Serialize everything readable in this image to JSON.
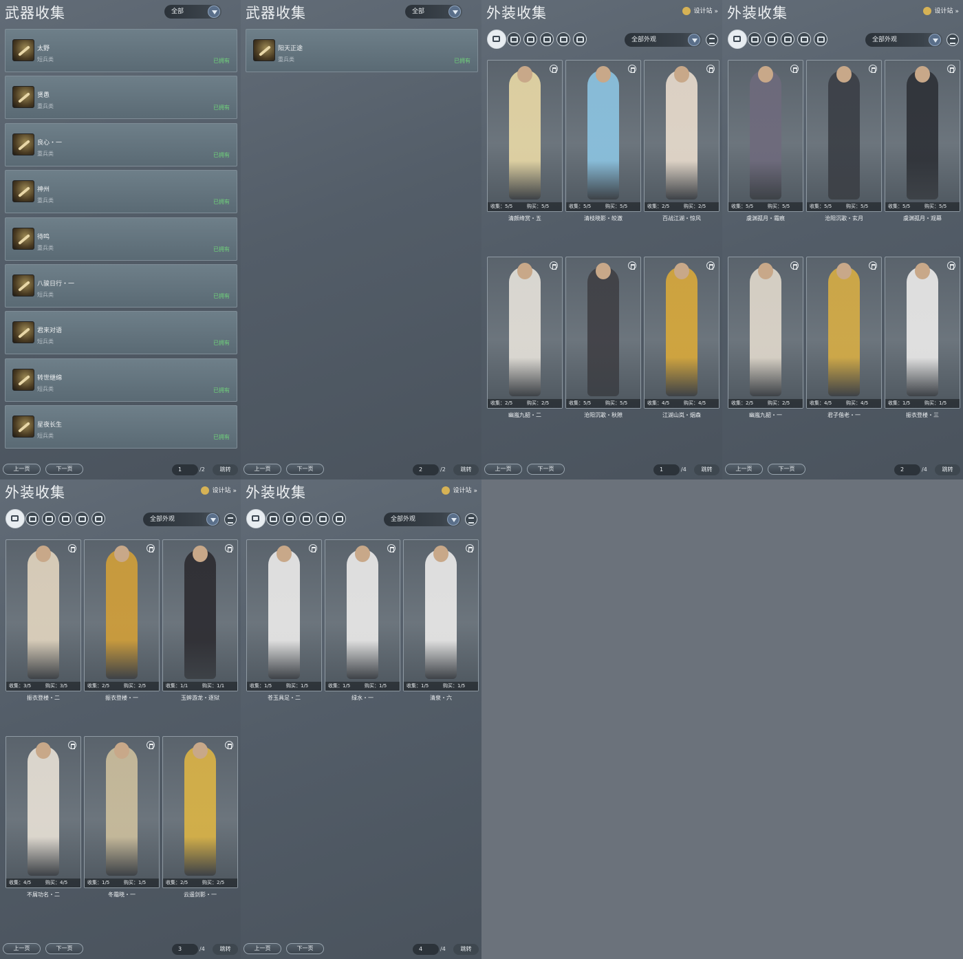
{
  "colors": {
    "owned": "#6fd27a",
    "accent": "#5a6f8a"
  },
  "weapon_panels": [
    {
      "title": "武器收集",
      "filter": "全部",
      "items": [
        {
          "name": "太野",
          "type": "短兵类",
          "status": "已拥有"
        },
        {
          "name": "贤愚",
          "type": "重兵类",
          "status": "已拥有"
        },
        {
          "name": "良心・一",
          "type": "重兵类",
          "status": "已拥有"
        },
        {
          "name": "神州",
          "type": "重兵类",
          "status": "已拥有"
        },
        {
          "name": "待鸣",
          "type": "重兵类",
          "status": "已拥有"
        },
        {
          "name": "八骏日行・一",
          "type": "短兵类",
          "status": "已拥有"
        },
        {
          "name": "君来对语",
          "type": "短兵类",
          "status": "已拥有"
        },
        {
          "name": "转世继绵",
          "type": "短兵类",
          "status": "已拥有"
        },
        {
          "name": "星夜长生",
          "type": "短兵类",
          "status": "已拥有"
        }
      ],
      "pager": {
        "prev": "上一页",
        "next": "下一页",
        "page": "1",
        "total": "/2",
        "jump": "跳转"
      }
    },
    {
      "title": "武器收集",
      "filter": "全部",
      "items": [
        {
          "name": "阳天正途",
          "type": "重兵类",
          "status": "已拥有"
        }
      ],
      "pager": {
        "prev": "上一页",
        "next": "下一页",
        "page": "2",
        "total": "/2",
        "jump": "跳转"
      }
    }
  ],
  "outfit_panels": [
    {
      "title": "外装收集",
      "design": "设计站",
      "filter": "全部外观",
      "cards": [
        {
          "name": "清颜绛赏・五",
          "collect": "收集：5/5",
          "buy": "购买：5/5",
          "color": "#e9d9a6"
        },
        {
          "name": "清枝晓影・皎澈",
          "collect": "收集：5/5",
          "buy": "购买：5/5",
          "color": "#8cc4e2"
        },
        {
          "name": "百战江湖・惊风",
          "collect": "收集：2/5",
          "buy": "购买：2/5",
          "color": "#e9dccd"
        },
        {
          "name": "幽嵐九韶・二",
          "collect": "收集：2/5",
          "buy": "购买：2/5",
          "color": "#e6e2da"
        },
        {
          "name": "沧阳沉歌・秋隙",
          "collect": "收集：5/5",
          "buy": "购买：5/5",
          "color": "#3f3f44"
        },
        {
          "name": "江湖山岚・烟森",
          "collect": "收集：4/5",
          "buy": "购买：4/5",
          "color": "#d9a93a"
        }
      ],
      "pager": {
        "prev": "上一页",
        "next": "下一页",
        "page": "1",
        "total": "/4",
        "jump": "跳转"
      }
    },
    {
      "title": "外装收集",
      "design": "设计站",
      "filter": "全部外观",
      "cards": [
        {
          "name": "虞渊孤月・霜痕",
          "collect": "收集：5/5",
          "buy": "购买：5/5",
          "color": "#6e6a7c"
        },
        {
          "name": "沧阳沉歌・玄月",
          "collect": "收集：5/5",
          "buy": "购买：5/5",
          "color": "#3a3e45"
        },
        {
          "name": "虞渊孤月・观幕",
          "collect": "收集：5/5",
          "buy": "购买：5/5",
          "color": "#2d3036"
        },
        {
          "name": "幽嵐九韶・一",
          "collect": "收集：2/5",
          "buy": "购买：2/5",
          "color": "#e1d9cc"
        },
        {
          "name": "君子偕老・一",
          "collect": "收集：4/5",
          "buy": "购买：4/5",
          "color": "#d7ad44"
        },
        {
          "name": "振衣登楼・三",
          "collect": "收集：1/5",
          "buy": "购买：1/5",
          "color": "#ecebea"
        }
      ],
      "pager": {
        "prev": "上一页",
        "next": "下一页",
        "page": "2",
        "total": "/4",
        "jump": "跳转"
      }
    },
    {
      "title": "外装收集",
      "design": "设计站",
      "filter": "全部外观",
      "cards": [
        {
          "name": "振衣登楼・二",
          "collect": "收集：3/5",
          "buy": "购买：3/5",
          "color": "#e2d5bf"
        },
        {
          "name": "振衣登楼・一",
          "collect": "收集：2/5",
          "buy": "购买：2/5",
          "color": "#d29f38"
        },
        {
          "name": "玉蟀游龙・逐狱",
          "collect": "收集：1/1",
          "buy": "购买：1/1",
          "color": "#2c2b30"
        },
        {
          "name": "不屑功名・二",
          "collect": "收集：4/5",
          "buy": "购买：4/5",
          "color": "#e8e1d6"
        },
        {
          "name": "冬霜晓・一",
          "collect": "收集：1/5",
          "buy": "购买：1/5",
          "color": "#cdbf9d"
        },
        {
          "name": "云遥剑影・一",
          "collect": "收集：2/5",
          "buy": "购买：2/5",
          "color": "#dcb445"
        }
      ],
      "pager": {
        "prev": "上一页",
        "next": "下一页",
        "page": "3",
        "total": "/4",
        "jump": "跳转"
      }
    },
    {
      "title": "外装收集",
      "design": "设计站",
      "filter": "全部外观",
      "cards": [
        {
          "name": "苍玉具足・二",
          "collect": "收集：1/5",
          "buy": "购买：1/5",
          "color": "#ecebea"
        },
        {
          "name": "绿水・一",
          "collect": "收集：1/5",
          "buy": "购买：1/5",
          "color": "#ecebea"
        },
        {
          "name": "清泉・六",
          "collect": "收集：1/5",
          "buy": "购买：1/5",
          "color": "#ecebea"
        }
      ],
      "pager": {
        "prev": "上一页",
        "next": "下一页",
        "page": "4",
        "total": "/4",
        "jump": "跳转"
      }
    }
  ]
}
